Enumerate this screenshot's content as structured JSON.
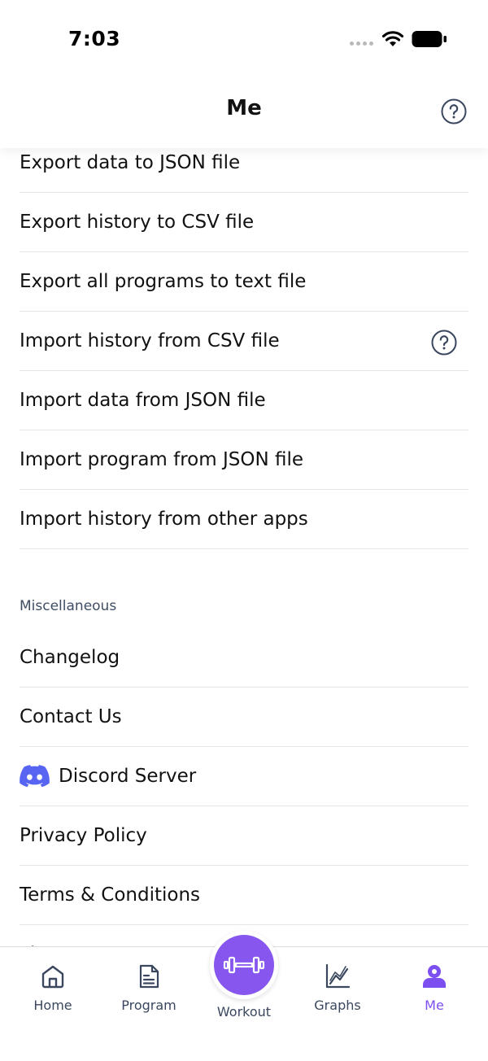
{
  "status_bar": {
    "time": "7:03"
  },
  "header": {
    "title": "Me"
  },
  "data_items": [
    {
      "label": "Export data to JSON file"
    },
    {
      "label": "Export history to CSV file"
    },
    {
      "label": "Export all programs to text file"
    },
    {
      "label": "Import history from CSV file",
      "has_help": true
    },
    {
      "label": "Import data from JSON file"
    },
    {
      "label": "Import program from JSON file"
    },
    {
      "label": "Import history from other apps"
    }
  ],
  "misc_section": {
    "title": "Miscellaneous",
    "items": [
      {
        "label": "Changelog"
      },
      {
        "label": "Contact Us"
      },
      {
        "label": "Discord Server",
        "icon": "discord-icon"
      },
      {
        "label": "Privacy Policy"
      },
      {
        "label": "Terms & Conditions"
      },
      {
        "label": "Li"
      }
    ]
  },
  "bottom_nav": {
    "home": {
      "label": "Home",
      "icon": "home-icon"
    },
    "program": {
      "label": "Program",
      "icon": "document-icon"
    },
    "workout": {
      "label": "Workout",
      "icon": "dumbbell-icon"
    },
    "graphs": {
      "label": "Graphs",
      "icon": "chart-line-icon"
    },
    "me": {
      "label": "Me",
      "icon": "user-icon",
      "active": true
    }
  },
  "colors": {
    "accent": "#8756ee",
    "discord": "#5865f2",
    "text": "#111111",
    "muted": "#3a475e"
  }
}
